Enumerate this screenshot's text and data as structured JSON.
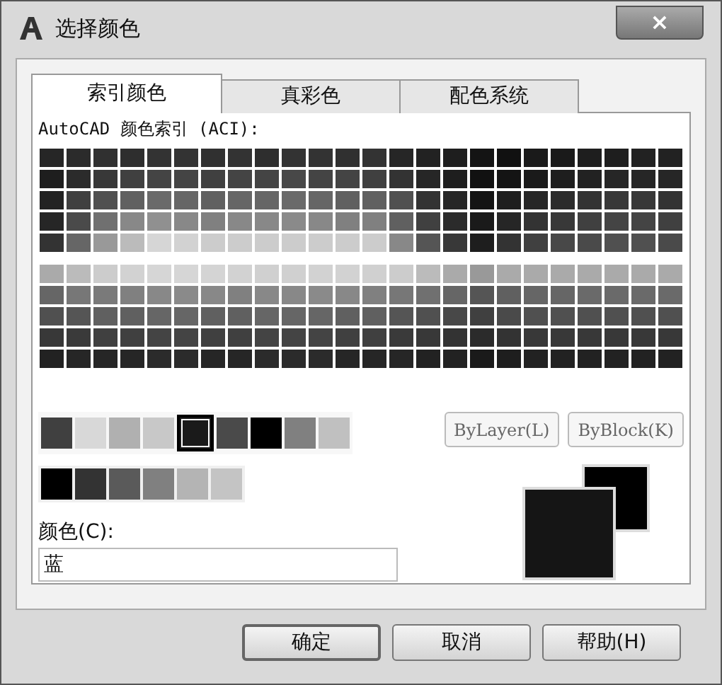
{
  "window": {
    "title": "选择颜色",
    "close": "×"
  },
  "tabs": [
    {
      "label": "索引颜色",
      "selected": true
    },
    {
      "label": "真彩色",
      "selected": false
    },
    {
      "label": "配色系统",
      "selected": false
    }
  ],
  "aci": {
    "label": "AutoCAD 颜色索引 (ACI):",
    "top_rows": [
      [
        {
          "color": "#262626"
        },
        {
          "color": "#2b2b2b"
        },
        {
          "color": "#303030"
        },
        {
          "color": "#2e2e2e"
        },
        {
          "color": "#333333"
        },
        {
          "color": "#333333"
        },
        {
          "color": "#303030"
        },
        {
          "color": "#333333"
        },
        {
          "color": "#2e2e2e"
        },
        {
          "color": "#333333"
        },
        {
          "color": "#333333"
        },
        {
          "color": "#303030"
        },
        {
          "color": "#333333"
        },
        {
          "color": "#262626"
        },
        {
          "color": "#222222"
        },
        {
          "color": "#1e1e1e"
        },
        {
          "color": "#141414"
        },
        {
          "color": "#111111"
        },
        {
          "color": "#1a1a1a"
        },
        {
          "color": "#1a1a1a"
        },
        {
          "color": "#1e1e1e"
        },
        {
          "color": "#1e1e1e"
        },
        {
          "color": "#222222"
        },
        {
          "color": "#222222"
        }
      ],
      [
        {
          "color": "#1e1e1e"
        },
        {
          "color": "#2b2b2b"
        },
        {
          "color": "#383838"
        },
        {
          "color": "#404040"
        },
        {
          "color": "#444444"
        },
        {
          "color": "#444444"
        },
        {
          "color": "#404040"
        },
        {
          "color": "#444444"
        },
        {
          "color": "#444444"
        },
        {
          "color": "#484848"
        },
        {
          "color": "#444444"
        },
        {
          "color": "#444444"
        },
        {
          "color": "#404040"
        },
        {
          "color": "#333333"
        },
        {
          "color": "#262626"
        },
        {
          "color": "#1e1e1e"
        },
        {
          "color": "#111111"
        },
        {
          "color": "#141414"
        },
        {
          "color": "#1a1a1a"
        },
        {
          "color": "#1e1e1e"
        },
        {
          "color": "#222222"
        },
        {
          "color": "#262626"
        },
        {
          "color": "#262626"
        },
        {
          "color": "#262626"
        }
      ],
      [
        {
          "color": "#222222"
        },
        {
          "color": "#404040"
        },
        {
          "color": "#505050"
        },
        {
          "color": "#606060"
        },
        {
          "color": "#6a6a6a"
        },
        {
          "color": "#666666"
        },
        {
          "color": "#606060"
        },
        {
          "color": "#666666"
        },
        {
          "color": "#666666"
        },
        {
          "color": "#6a6a6a"
        },
        {
          "color": "#666666"
        },
        {
          "color": "#606060"
        },
        {
          "color": "#606060"
        },
        {
          "color": "#505050"
        },
        {
          "color": "#333333"
        },
        {
          "color": "#262626"
        },
        {
          "color": "#141414"
        },
        {
          "color": "#1e1e1e"
        },
        {
          "color": "#262626"
        },
        {
          "color": "#2b2b2b"
        },
        {
          "color": "#333333"
        },
        {
          "color": "#383838"
        },
        {
          "color": "#383838"
        },
        {
          "color": "#333333"
        }
      ],
      [
        {
          "color": "#262626"
        },
        {
          "color": "#4a4a4a"
        },
        {
          "color": "#707070"
        },
        {
          "color": "#888888"
        },
        {
          "color": "#909090"
        },
        {
          "color": "#888888"
        },
        {
          "color": "#808080"
        },
        {
          "color": "#888888"
        },
        {
          "color": "#888888"
        },
        {
          "color": "#8a8a8a"
        },
        {
          "color": "#888888"
        },
        {
          "color": "#808080"
        },
        {
          "color": "#808080"
        },
        {
          "color": "#606060"
        },
        {
          "color": "#404040"
        },
        {
          "color": "#2b2b2b"
        },
        {
          "color": "#1a1a1a"
        },
        {
          "color": "#262626"
        },
        {
          "color": "#333333"
        },
        {
          "color": "#383838"
        },
        {
          "color": "#404040"
        },
        {
          "color": "#444444"
        },
        {
          "color": "#444444"
        },
        {
          "color": "#404040"
        }
      ],
      [
        {
          "color": "#333333"
        },
        {
          "color": "#666666"
        },
        {
          "color": "#999999"
        },
        {
          "color": "#bbbbbb"
        },
        {
          "color": "#d6d6d6"
        },
        {
          "color": "#d2d2d2"
        },
        {
          "color": "#cccccc"
        },
        {
          "color": "#cccccc"
        },
        {
          "color": "#cccccc"
        },
        {
          "color": "#cccccc"
        },
        {
          "color": "#cccccc"
        },
        {
          "color": "#cccccc"
        },
        {
          "color": "#cccccc"
        },
        {
          "color": "#888888"
        },
        {
          "color": "#555555"
        },
        {
          "color": "#383838"
        },
        {
          "color": "#1e1e1e"
        },
        {
          "color": "#333333"
        },
        {
          "color": "#404040"
        },
        {
          "color": "#484848"
        },
        {
          "color": "#4a4a4a"
        },
        {
          "color": "#505050"
        },
        {
          "color": "#505050"
        },
        {
          "color": "#4a4a4a"
        }
      ]
    ],
    "bottom_rows": [
      [
        {
          "color": "#aaaaaa"
        },
        {
          "color": "#bbbbbb"
        },
        {
          "color": "#cccccc"
        },
        {
          "color": "#d2d2d2"
        },
        {
          "color": "#d6d6d6"
        },
        {
          "color": "#d6d6d6"
        },
        {
          "color": "#d4d4d4"
        },
        {
          "color": "#d2d2d2"
        },
        {
          "color": "#d0d0d0"
        },
        {
          "color": "#d0d0d0"
        },
        {
          "color": "#d2d2d2"
        },
        {
          "color": "#d2d2d2"
        },
        {
          "color": "#d0d0d0"
        },
        {
          "color": "#cccccc"
        },
        {
          "color": "#bbbbbb"
        },
        {
          "color": "#aaaaaa"
        },
        {
          "color": "#999999"
        },
        {
          "color": "#aaaaaa"
        },
        {
          "color": "#aaaaaa"
        },
        {
          "color": "#aaaaaa"
        },
        {
          "color": "#aaaaaa"
        },
        {
          "color": "#aaaaaa"
        },
        {
          "color": "#aaaaaa"
        },
        {
          "color": "#aaaaaa"
        }
      ],
      [
        {
          "color": "#666666"
        },
        {
          "color": "#777777"
        },
        {
          "color": "#7a7a7a"
        },
        {
          "color": "#808080"
        },
        {
          "color": "#888888"
        },
        {
          "color": "#8a8a8a"
        },
        {
          "color": "#888888"
        },
        {
          "color": "#808080"
        },
        {
          "color": "#888888"
        },
        {
          "color": "#888888"
        },
        {
          "color": "#8a8a8a"
        },
        {
          "color": "#888888"
        },
        {
          "color": "#808080"
        },
        {
          "color": "#777777"
        },
        {
          "color": "#707070"
        },
        {
          "color": "#666666"
        },
        {
          "color": "#555555"
        },
        {
          "color": "#606060"
        },
        {
          "color": "#666666"
        },
        {
          "color": "#666666"
        },
        {
          "color": "#6a6a6a"
        },
        {
          "color": "#6a6a6a"
        },
        {
          "color": "#6a6a6a"
        },
        {
          "color": "#6a6a6a"
        }
      ],
      [
        {
          "color": "#505050"
        },
        {
          "color": "#555555"
        },
        {
          "color": "#606060"
        },
        {
          "color": "#606060"
        },
        {
          "color": "#666666"
        },
        {
          "color": "#666666"
        },
        {
          "color": "#606060"
        },
        {
          "color": "#606060"
        },
        {
          "color": "#666666"
        },
        {
          "color": "#666666"
        },
        {
          "color": "#666666"
        },
        {
          "color": "#606060"
        },
        {
          "color": "#606060"
        },
        {
          "color": "#555555"
        },
        {
          "color": "#505050"
        },
        {
          "color": "#484848"
        },
        {
          "color": "#404040"
        },
        {
          "color": "#4a4a4a"
        },
        {
          "color": "#505050"
        },
        {
          "color": "#505050"
        },
        {
          "color": "#505050"
        },
        {
          "color": "#505050"
        },
        {
          "color": "#505050"
        },
        {
          "color": "#505050"
        }
      ],
      [
        {
          "color": "#383838"
        },
        {
          "color": "#3a3a3a"
        },
        {
          "color": "#404040"
        },
        {
          "color": "#404040"
        },
        {
          "color": "#444444"
        },
        {
          "color": "#444444"
        },
        {
          "color": "#404040"
        },
        {
          "color": "#404040"
        },
        {
          "color": "#444444"
        },
        {
          "color": "#444444"
        },
        {
          "color": "#444444"
        },
        {
          "color": "#404040"
        },
        {
          "color": "#404040"
        },
        {
          "color": "#3a3a3a"
        },
        {
          "color": "#383838"
        },
        {
          "color": "#333333"
        },
        {
          "color": "#2b2b2b"
        },
        {
          "color": "#333333"
        },
        {
          "color": "#383838"
        },
        {
          "color": "#383838"
        },
        {
          "color": "#383838"
        },
        {
          "color": "#383838"
        },
        {
          "color": "#383838"
        },
        {
          "color": "#383838"
        }
      ],
      [
        {
          "color": "#222222"
        },
        {
          "color": "#262626"
        },
        {
          "color": "#262626"
        },
        {
          "color": "#262626"
        },
        {
          "color": "#2b2b2b"
        },
        {
          "color": "#2b2b2b"
        },
        {
          "color": "#262626"
        },
        {
          "color": "#262626"
        },
        {
          "color": "#2b2b2b"
        },
        {
          "color": "#2b2b2b"
        },
        {
          "color": "#2b2b2b"
        },
        {
          "color": "#262626"
        },
        {
          "color": "#262626"
        },
        {
          "color": "#262626"
        },
        {
          "color": "#222222"
        },
        {
          "color": "#222222"
        },
        {
          "color": "#1a1a1a"
        },
        {
          "color": "#1e1e1e"
        },
        {
          "color": "#222222"
        },
        {
          "color": "#222222"
        },
        {
          "color": "#222222"
        },
        {
          "color": "#222222"
        },
        {
          "color": "#222222"
        },
        {
          "color": "#222222"
        }
      ]
    ]
  },
  "standard_colors": [
    {
      "color": "#404040",
      "selected": false
    },
    {
      "color": "#d8d8d8",
      "selected": false
    },
    {
      "color": "#b0b0b0",
      "selected": false
    },
    {
      "color": "#c8c8c8",
      "selected": false
    },
    {
      "color": "#1a1a1a",
      "selected": true
    },
    {
      "color": "#4a4a4a",
      "selected": false
    },
    {
      "color": "#000000",
      "selected": false
    },
    {
      "color": "#808080",
      "selected": false
    },
    {
      "color": "#c0c0c0",
      "selected": false
    }
  ],
  "gray_colors": [
    {
      "color": "#000000",
      "selected": false
    },
    {
      "color": "#333333",
      "selected": false
    },
    {
      "color": "#5a5a5a",
      "selected": false
    },
    {
      "color": "#808080",
      "selected": false
    },
    {
      "color": "#b4b4b4",
      "selected": false
    },
    {
      "color": "#c4c4c4",
      "selected": false
    }
  ],
  "special_buttons": [
    "ByLayer(L)",
    "ByBlock(K)"
  ],
  "color_field": {
    "label": "颜色(C):",
    "value": "蓝"
  },
  "preview": {
    "old": {
      "color": "#000000"
    },
    "new": {
      "color": "#151515"
    }
  },
  "buttons": [
    "确定",
    "取消",
    "帮助(H)"
  ]
}
